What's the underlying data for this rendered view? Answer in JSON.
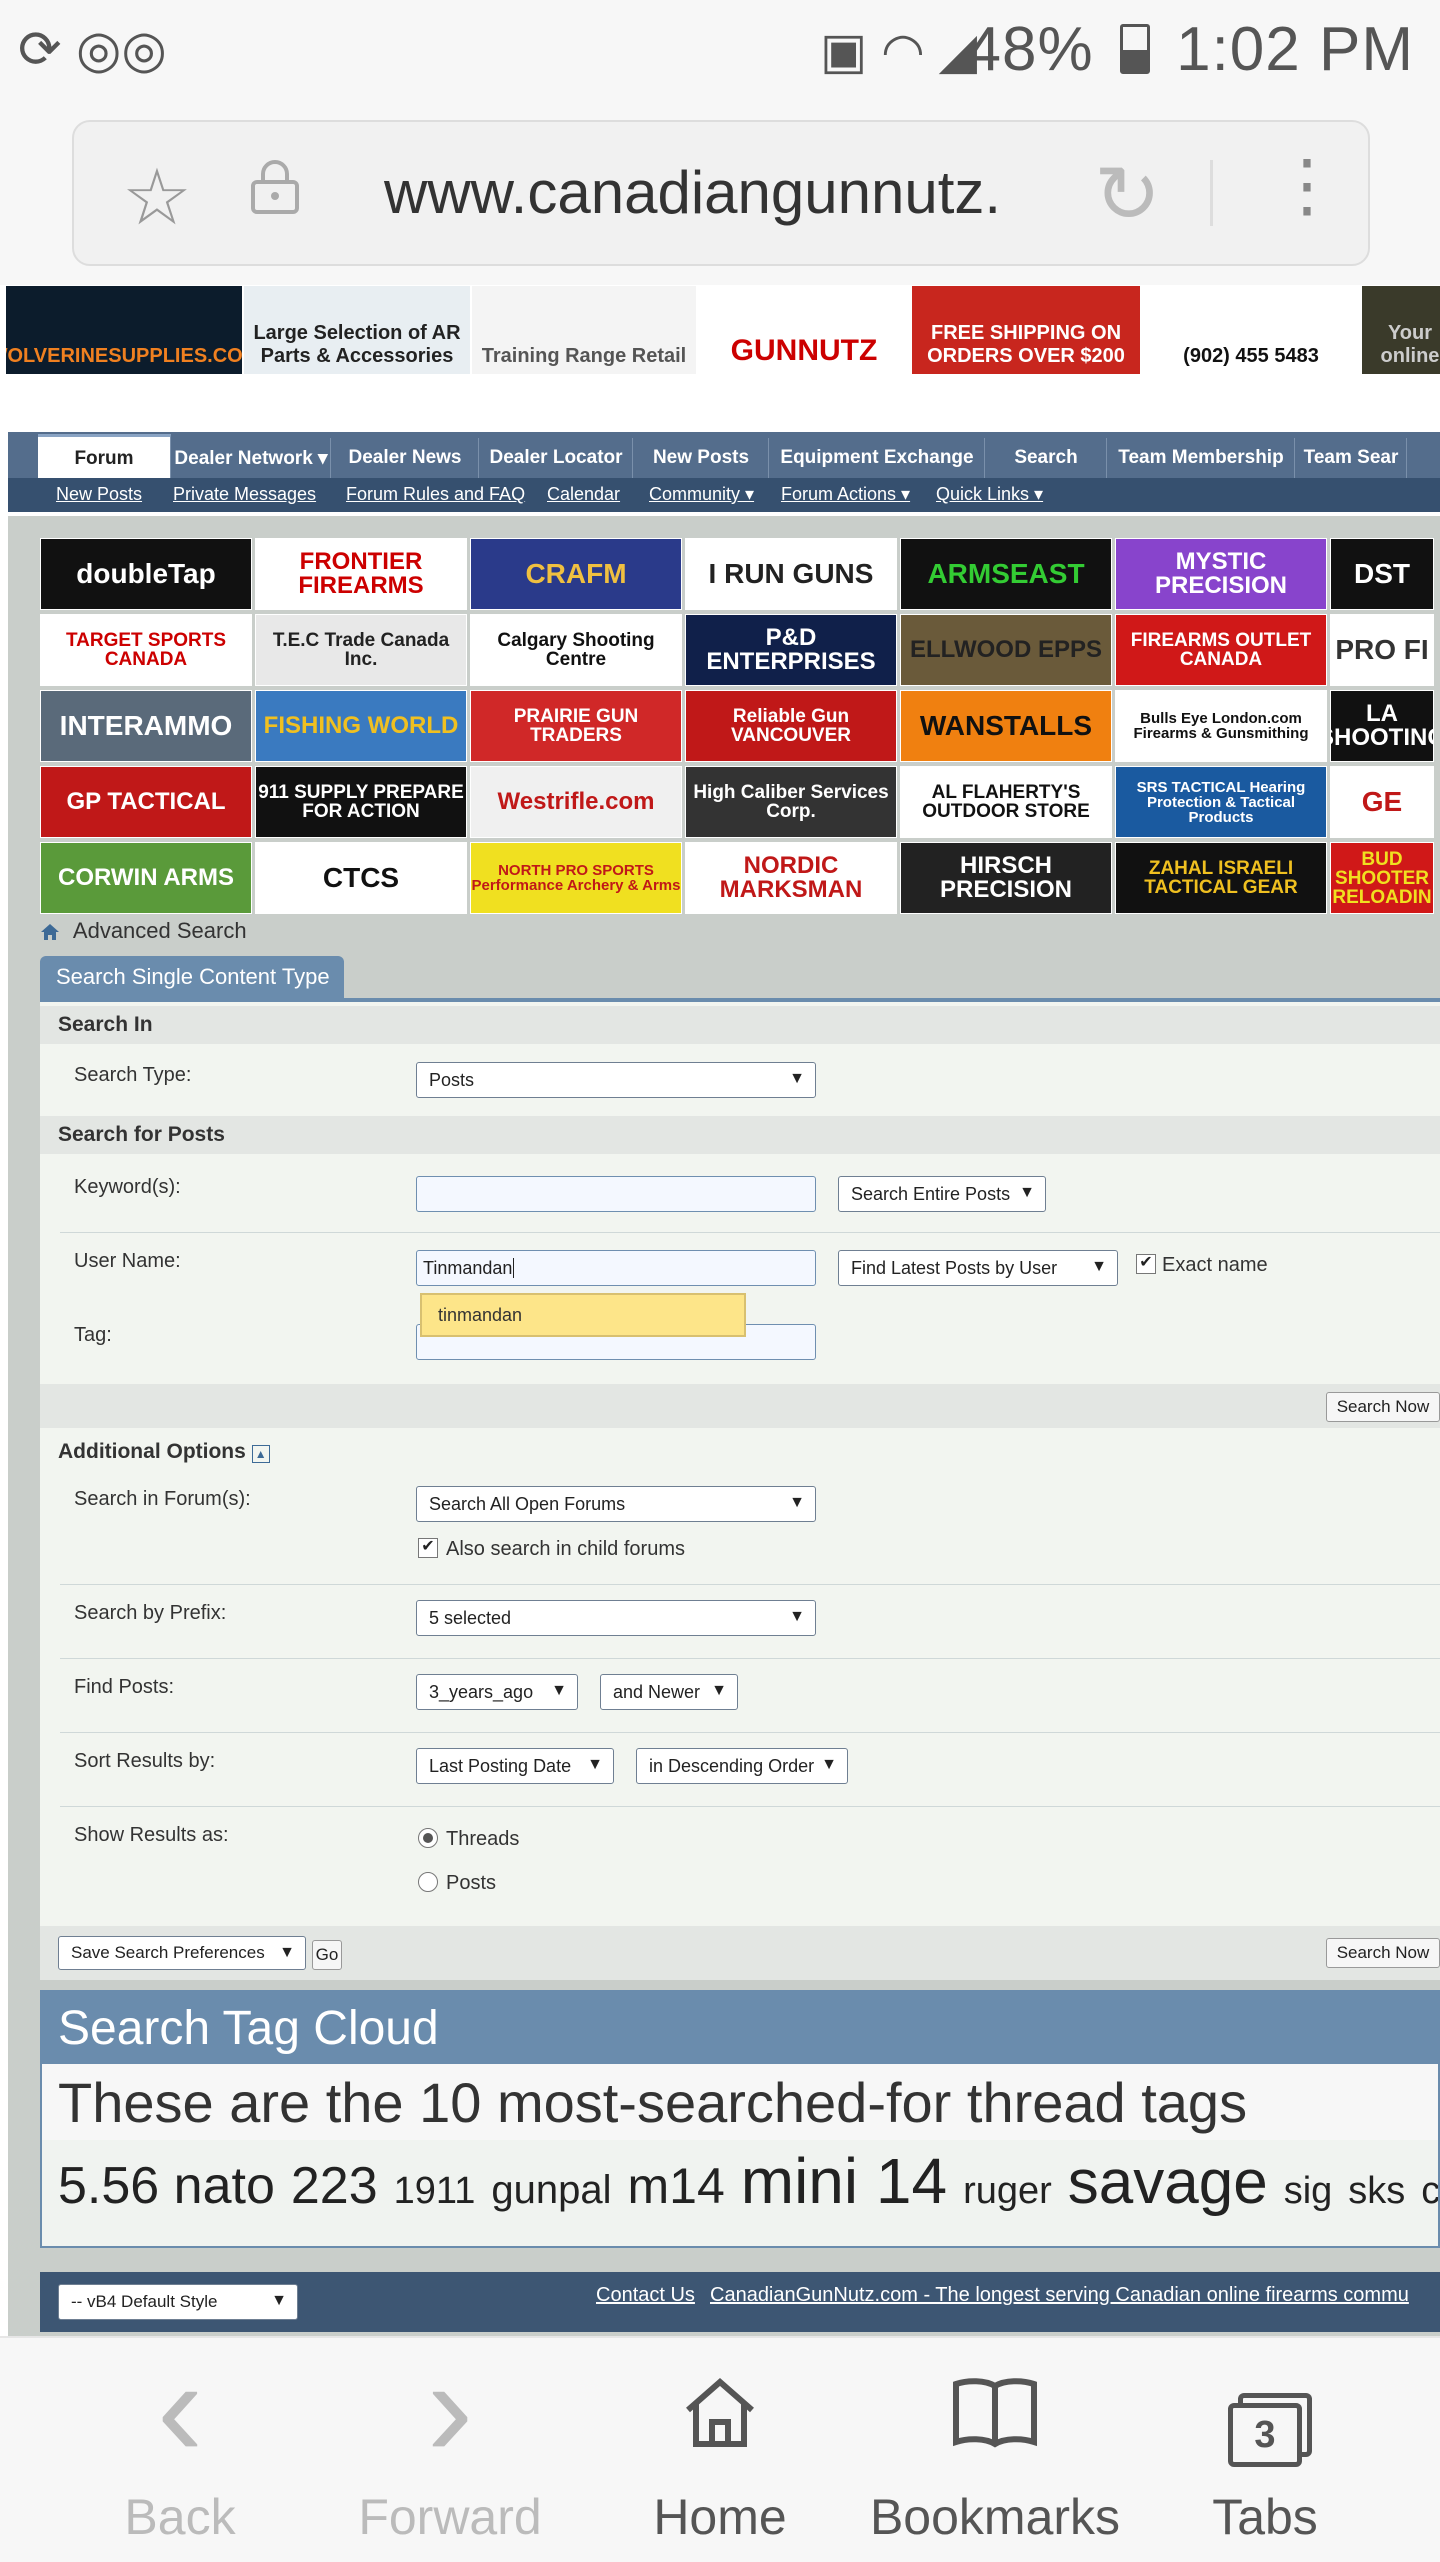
{
  "status_bar": {
    "battery": "48%",
    "time": "1:02 PM"
  },
  "browser": {
    "url": "www.canadiangunnutz."
  },
  "banner": [
    {
      "text": "WOLVERINESUPPLIES.COM",
      "bg": "#0c1c2c",
      "color": "#f08020"
    },
    {
      "text": "Large Selection of AR Parts & Accessories",
      "bg": "#e8eef2",
      "color": "#222"
    },
    {
      "text": "Training Range Retail",
      "bg": "#f4f4f4",
      "color": "#555"
    },
    {
      "text": "GUNNUTZ",
      "bg": "#ffffff",
      "color": "#c00"
    },
    {
      "text": "FREE SHIPPING ON ORDERS OVER $200",
      "bg": "#c8261e",
      "color": "#fff"
    },
    {
      "text": "(902) 455 5483",
      "bg": "#ffffff",
      "color": "#111"
    },
    {
      "text": "Your online",
      "bg": "#3a3a2a",
      "color": "#ccc"
    }
  ],
  "nav_tabs": [
    "Forum",
    "Dealer Network",
    "Dealer News",
    "Dealer Locator",
    "New Posts",
    "Equipment Exchange",
    "Search",
    "Team Membership",
    "Team Sear"
  ],
  "sub_links": [
    "New Posts",
    "Private Messages",
    "Forum Rules and FAQ",
    "Calendar",
    "Community",
    "Forum Actions",
    "Quick Links"
  ],
  "sponsor_logos": [
    {
      "text": "doubleTap",
      "bg": "#111",
      "color": "#fff"
    },
    {
      "text": "FRONTIER FIREARMS",
      "bg": "#fff",
      "color": "#c00"
    },
    {
      "text": "CRAFM",
      "bg": "#2a3a8a",
      "color": "#f0c040"
    },
    {
      "text": "I RUN GUNS",
      "bg": "#fff",
      "color": "#222"
    },
    {
      "text": "ARMSEAST",
      "bg": "#111",
      "color": "#3c3"
    },
    {
      "text": "MYSTIC PRECISION",
      "bg": "#8844cc",
      "color": "#fff"
    },
    {
      "text": "DST",
      "bg": "#111",
      "color": "#fff"
    },
    {
      "text": "TARGET SPORTS CANADA",
      "bg": "#fff",
      "color": "#c00"
    },
    {
      "text": "T.E.C Trade Canada Inc.",
      "bg": "#e8e8e8",
      "color": "#222"
    },
    {
      "text": "Calgary Shooting Centre",
      "bg": "#fff",
      "color": "#111"
    },
    {
      "text": "P&D ENTERPRISES",
      "bg": "#10204a",
      "color": "#fff"
    },
    {
      "text": "ELLWOOD EPPS",
      "bg": "#6a5a3a",
      "color": "#222"
    },
    {
      "text": "FIREARMS OUTLET CANADA",
      "bg": "#d01818",
      "color": "#fff"
    },
    {
      "text": "PRO FI",
      "bg": "#fff",
      "color": "#333"
    },
    {
      "text": "INTERAMMO",
      "bg": "#5a6a7a",
      "color": "#fff"
    },
    {
      "text": "FISHING WORLD",
      "bg": "#3a7ac0",
      "color": "#f0c020"
    },
    {
      "text": "PRAIRIE GUN TRADERS",
      "bg": "#d02828",
      "color": "#fff"
    },
    {
      "text": "Reliable Gun VANCOUVER",
      "bg": "#c01818",
      "color": "#fff"
    },
    {
      "text": "WANSTALLS",
      "bg": "#f08010",
      "color": "#111"
    },
    {
      "text": "Bulls Eye London.com Firearms & Gunsmithing",
      "bg": "#fff",
      "color": "#111"
    },
    {
      "text": "LA SHOOTING",
      "bg": "#111",
      "color": "#fff"
    },
    {
      "text": "GP TACTICAL",
      "bg": "#c01818",
      "color": "#fff"
    },
    {
      "text": "911 SUPPLY PREPARE FOR ACTION",
      "bg": "#111",
      "color": "#fff"
    },
    {
      "text": "Westrifle.com",
      "bg": "#f0f0f0",
      "color": "#c01818"
    },
    {
      "text": "High Caliber Services Corp.",
      "bg": "#333",
      "color": "#fff"
    },
    {
      "text": "AL FLAHERTY'S OUTDOOR STORE",
      "bg": "#fff",
      "color": "#111"
    },
    {
      "text": "SRS TACTICAL Hearing Protection & Tactical Products",
      "bg": "#1a5aa0",
      "color": "#fff"
    },
    {
      "text": "GE",
      "bg": "#fff",
      "color": "#c01818"
    },
    {
      "text": "CORWIN ARMS",
      "bg": "#5a9a3a",
      "color": "#fff"
    },
    {
      "text": "CTCS",
      "bg": "#fff",
      "color": "#111"
    },
    {
      "text": "NORTH PRO SPORTS Performance Archery & Arms",
      "bg": "#f0e020",
      "color": "#c01818"
    },
    {
      "text": "NORDIC MARKSMAN",
      "bg": "#fff",
      "color": "#c01818"
    },
    {
      "text": "HIRSCH PRECISION",
      "bg": "#222",
      "color": "#fff"
    },
    {
      "text": "ZAHAL ISRAELI TACTICAL GEAR",
      "bg": "#111",
      "color": "#f0c020"
    },
    {
      "text": "BUD SHOOTER RELOADIN",
      "bg": "#d01818",
      "color": "#f0e020"
    }
  ],
  "breadcrumb": "Advanced Search",
  "search_tab": "Search Single Content Type",
  "form": {
    "search_in_header": "Search In",
    "search_type_label": "Search Type:",
    "search_type_value": "Posts",
    "search_for_header": "Search for Posts",
    "keywords_label": "Keyword(s):",
    "keywords_value": "",
    "keywords_scope": "Search Entire Posts",
    "username_label": "User Name:",
    "username_value": "Tinmandan",
    "username_mode": "Find Latest Posts by User",
    "exact_name_label": "Exact name",
    "autocomplete": "tinmandan",
    "tag_label": "Tag:",
    "search_now": "Search Now",
    "additional_header": "Additional Options",
    "forums_label": "Search in Forum(s):",
    "forums_value": "Search All Open Forums",
    "child_forums_label": "Also search in child forums",
    "prefix_label": "Search by Prefix:",
    "prefix_value": "5 selected",
    "find_posts_label": "Find Posts:",
    "find_posts_value": "3_years_ago",
    "find_posts_dir": "and Newer",
    "sort_label": "Sort Results by:",
    "sort_value": "Last Posting Date",
    "sort_order": "in Descending Order",
    "show_label": "Show Results as:",
    "show_threads": "Threads",
    "show_posts": "Posts",
    "save_prefs": "Save Search Preferences",
    "go": "Go"
  },
  "tag_cloud": {
    "title": "Search Tag Cloud",
    "subtitle": "These are the 10 most-searched-for thread tags",
    "tags": [
      {
        "text": "5.56 nato",
        "size": 52
      },
      {
        "text": "223",
        "size": 52
      },
      {
        "text": "1911",
        "size": 38
      },
      {
        "text": "gunpal",
        "size": 40
      },
      {
        "text": "m14",
        "size": 50
      },
      {
        "text": "mini 14",
        "size": 64
      },
      {
        "text": "ruger",
        "size": 38
      },
      {
        "text": "savage",
        "size": 62
      },
      {
        "text": "sig",
        "size": 38
      },
      {
        "text": "sks",
        "size": 38
      },
      {
        "text": "c",
        "size": 38
      }
    ]
  },
  "footer": {
    "style": "-- vB4 Default Style",
    "contact": "Contact Us",
    "site": "CanadianGunNutz.com - The longest serving Canadian online firearms commu"
  },
  "bottom_nav": [
    {
      "label": "Back",
      "icon": "chevron-left-icon",
      "glyph": "‹"
    },
    {
      "label": "Forward",
      "icon": "chevron-right-icon",
      "glyph": "›"
    },
    {
      "label": "Home",
      "icon": "home-icon",
      "glyph": "⌂"
    },
    {
      "label": "Bookmarks",
      "icon": "bookmarks-icon",
      "glyph": "🕮"
    },
    {
      "label": "Tabs",
      "icon": "tabs-icon",
      "glyph": "3"
    }
  ]
}
